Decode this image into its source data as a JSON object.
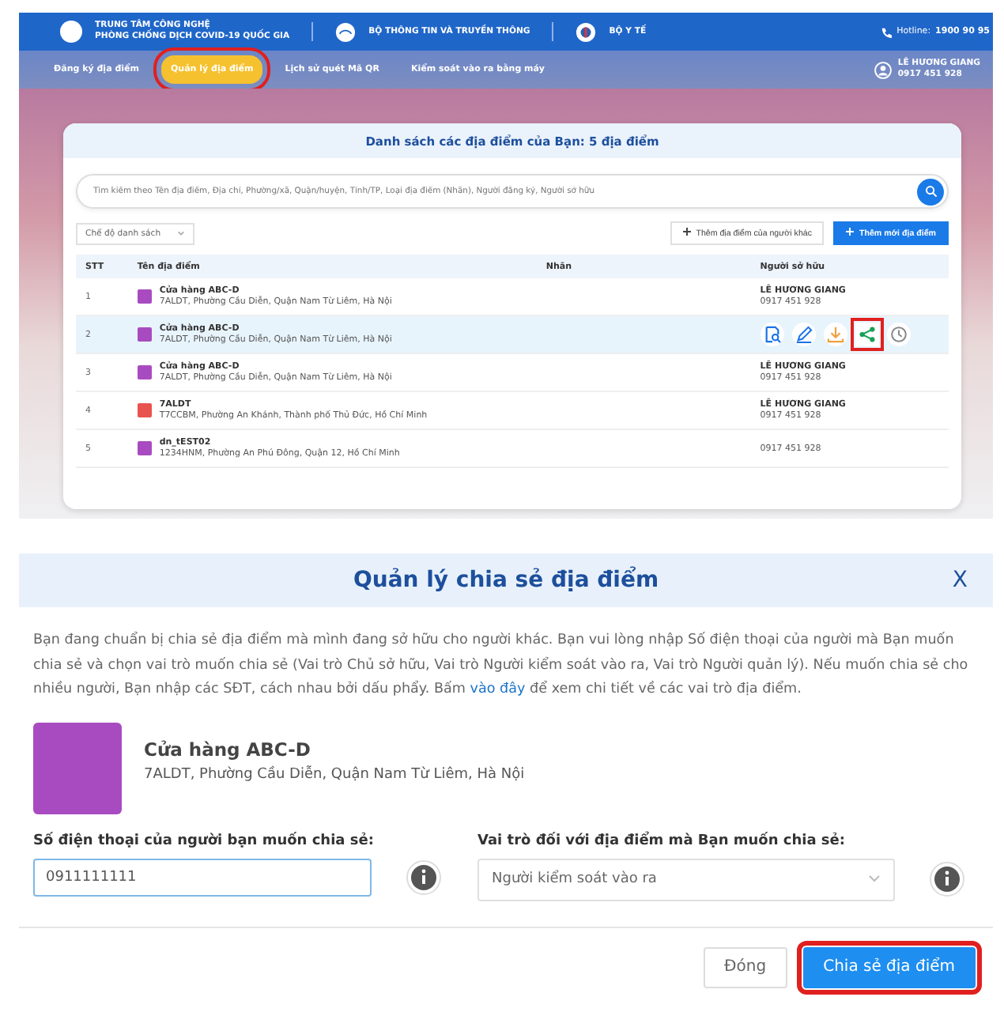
{
  "header": {
    "org_line_1": "TRUNG TÂM CÔNG NGHỆ",
    "org_line_2": "PHÒNG CHỐNG DỊCH COVID-19 QUỐC GIA",
    "ministry_1": "BỘ THÔNG TIN VÀ TRUYỀN THÔNG",
    "ministry_2": "BỘ Y TẾ",
    "hotline_label": "Hotline:",
    "hotline": "1900 90 95"
  },
  "nav": {
    "items": [
      {
        "label": "Đăng ký địa điểm",
        "selected": false,
        "highlighted": false
      },
      {
        "label": "Quản lý địa điểm",
        "selected": true,
        "highlighted": true
      },
      {
        "label": "Lịch sử quét Mã QR",
        "selected": false,
        "highlighted": false
      },
      {
        "label": "Kiểm soát vào ra bằng máy",
        "selected": false,
        "highlighted": false
      }
    ],
    "user": {
      "name": "LÊ HƯƠNG GIANG",
      "phone": "0917 451 928"
    }
  },
  "list": {
    "title": "Danh sách các địa điểm của Bạn: 5 địa điểm",
    "search": {
      "placeholder": "Tìm kiếm theo Tên địa điểm, Địa chỉ, Phường/xã, Quận/huyện, Tỉnh/TP, Loại địa điểm (Nhãn), Người đăng ký, Người sở hữu"
    },
    "view_mode": "Chế độ danh sách",
    "buttons": [
      {
        "label": "Thêm địa điểm của người khác",
        "kind": "secondary"
      },
      {
        "label": "Thêm mới địa điểm",
        "kind": "primary"
      }
    ],
    "columns": [
      "STT",
      "Tên địa điểm",
      "Nhãn",
      "Người sở hữu"
    ],
    "rows": [
      {
        "index": "1",
        "name": "Cửa hàng ABC-D",
        "address": "7ALDT, Phường Cầu Diễn, Quận Nam Từ Liêm, Hà Nội",
        "color": "#a94bc0",
        "owner": "LÊ HƯƠNG GIANG",
        "phone": "0917 451 928",
        "selected": false
      },
      {
        "index": "2",
        "name": "Cửa hàng ABC-D",
        "address": "7ALDT, Phường Cầu Diễn, Quận Nam Từ Liêm, Hà Nội",
        "color": "#a94bc0",
        "selected": true,
        "actions": [
          {
            "kind": "view",
            "highlighted": false
          },
          {
            "kind": "edit",
            "highlighted": false
          },
          {
            "kind": "download",
            "highlighted": false
          },
          {
            "kind": "share",
            "highlighted": true
          },
          {
            "kind": "history",
            "highlighted": false
          }
        ]
      },
      {
        "index": "3",
        "name": "Cửa hàng ABC-D",
        "address": "7ALDT, Phường Cầu Diễn, Quận Nam Từ Liêm, Hà Nội",
        "color": "#a94bc0",
        "owner": "LÊ HƯƠNG GIANG",
        "phone": "0917 451 928",
        "selected": false
      },
      {
        "index": "4",
        "name": "7ALDT",
        "address": "T7CCBM, Phường An Khánh, Thành phố Thủ Đức, Hồ Chí Minh",
        "color": "#e8534f",
        "owner": "LÊ HƯƠNG GIANG",
        "phone": "0917 451 928",
        "selected": false
      },
      {
        "index": "5",
        "name": "dn_tEST02",
        "address": "1234HNM, Phường An Phú Đông, Quận 12, Hồ Chí Minh",
        "color": "#a94bc0",
        "phone": "0917 451 928",
        "selected": false
      }
    ]
  },
  "dialog": {
    "title": "Quản lý chia sẻ địa điểm",
    "close": "X",
    "message_before": "Bạn đang chuẩn bị chia sẻ địa điểm mà mình đang sở hữu cho người khác. Bạn vui lòng nhập Số điện thoại của người mà Bạn muốn chia sẻ và chọn vai trò muốn chia sẻ (Vai trò Chủ sở hữu, Vai trò Người kiểm soát vào ra, Vai trò Người quản lý). Nếu muốn chia sẻ cho nhiều người, Bạn nhập các SĐT, cách nhau bởi dấu phẩy. Bấm",
    "link": "vào đây",
    "message_after": "để xem chi tiết về các vai trò địa điểm.",
    "place": {
      "name": "Cửa hàng ABC-D",
      "address": "7ALDT, Phường Cầu Diễn, Quận Nam Từ Liêm, Hà Nội",
      "color": "#a94bc0"
    },
    "phone_label": "Số điện thoại của người bạn muốn chia sẻ:",
    "phone_value": "0911111111",
    "role_label": "Vai trò đối với địa điểm mà Bạn muốn chia sẻ:",
    "role_value": "Người kiểm soát vào ra",
    "buttons": [
      {
        "label": "Đóng",
        "kind": "secondary",
        "highlighted": false
      },
      {
        "label": "Chia sẻ địa điểm",
        "kind": "primary",
        "highlighted": true
      }
    ]
  }
}
